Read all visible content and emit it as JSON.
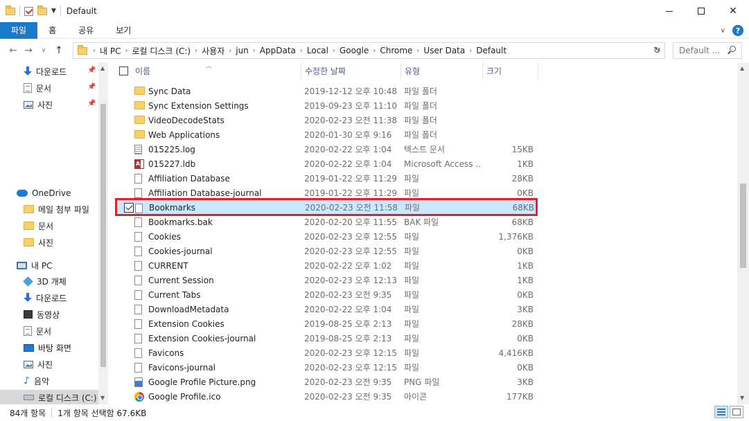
{
  "window": {
    "title": "Default"
  },
  "ribbon": {
    "tabs": [
      {
        "label": "파일"
      },
      {
        "label": "홈"
      },
      {
        "label": "공유"
      },
      {
        "label": "보기"
      }
    ]
  },
  "address": {
    "crumbs": [
      "내 PC",
      "로컬 디스크 (C:)",
      "사용자",
      "jun",
      "AppData",
      "Local",
      "Google",
      "Chrome",
      "User Data",
      "Default"
    ],
    "search_placeholder": "Default ..."
  },
  "sidebar": {
    "quick": [
      {
        "label": "다운로드",
        "icon": "download-icon"
      },
      {
        "label": "문서",
        "icon": "document-icon"
      },
      {
        "label": "사진",
        "icon": "pictures-icon"
      }
    ],
    "onedrive": {
      "label": "OneDrive",
      "icon": "onedrive-icon"
    },
    "onedrive_items": [
      {
        "label": "메일 첨부 파일"
      },
      {
        "label": "문서"
      },
      {
        "label": "사진"
      }
    ],
    "thispc": {
      "label": "내 PC",
      "icon": "pc-icon"
    },
    "pc_items": [
      {
        "label": "3D 개체",
        "icon": "3d-objects-icon"
      },
      {
        "label": "다운로드",
        "icon": "download-icon"
      },
      {
        "label": "동영상",
        "icon": "video-icon"
      },
      {
        "label": "문서",
        "icon": "document-icon"
      },
      {
        "label": "바탕 화면",
        "icon": "desktop-icon"
      },
      {
        "label": "사진",
        "icon": "pictures-icon"
      },
      {
        "label": "음악",
        "icon": "music-icon"
      },
      {
        "label": "로컬 디스크 (C:)",
        "icon": "drive-icon"
      }
    ]
  },
  "columns": {
    "name": "이름",
    "date": "수정한 날짜",
    "type": "유형",
    "size": "크기"
  },
  "files": [
    {
      "name": "Sync Data",
      "date": "2019-12-12 오후 10:48",
      "type": "파일 폴더",
      "size": "",
      "icon": "folder-icon"
    },
    {
      "name": "Sync Extension Settings",
      "date": "2019-09-23 오후 11:10",
      "type": "파일 폴더",
      "size": "",
      "icon": "folder-icon"
    },
    {
      "name": "VideoDecodeStats",
      "date": "2020-02-23 오전 11:38",
      "type": "파일 폴더",
      "size": "",
      "icon": "folder-icon"
    },
    {
      "name": "Web Applications",
      "date": "2020-01-30 오후 9:16",
      "type": "파일 폴더",
      "size": "",
      "icon": "folder-icon"
    },
    {
      "name": "015225.log",
      "date": "2020-02-22 오후 1:04",
      "type": "텍스트 문서",
      "size": "15KB",
      "icon": "text-file-icon"
    },
    {
      "name": "015227.ldb",
      "date": "2020-02-22 오후 1:04",
      "type": "Microsoft Access ...",
      "size": "1KB",
      "icon": "access-file-icon"
    },
    {
      "name": "Affiliation Database",
      "date": "2019-01-22 오후 11:29",
      "type": "파일",
      "size": "28KB",
      "icon": "file-icon"
    },
    {
      "name": "Affiliation Database-journal",
      "date": "2019-01-22 오후 11:29",
      "type": "파일",
      "size": "0KB",
      "icon": "file-icon"
    },
    {
      "name": "Bookmarks",
      "date": "2020-02-23 오전 11:58",
      "type": "파일",
      "size": "68KB",
      "icon": "file-icon",
      "selected": true
    },
    {
      "name": "Bookmarks.bak",
      "date": "2020-02-20 오후 11:55",
      "type": "BAK 파일",
      "size": "68KB",
      "icon": "file-icon"
    },
    {
      "name": "Cookies",
      "date": "2020-02-23 오후 12:55",
      "type": "파일",
      "size": "1,376KB",
      "icon": "file-icon"
    },
    {
      "name": "Cookies-journal",
      "date": "2020-02-23 오후 12:55",
      "type": "파일",
      "size": "0KB",
      "icon": "file-icon"
    },
    {
      "name": "CURRENT",
      "date": "2020-02-22 오후 1:02",
      "type": "파일",
      "size": "1KB",
      "icon": "file-icon"
    },
    {
      "name": "Current Session",
      "date": "2020-02-23 오후 12:13",
      "type": "파일",
      "size": "1KB",
      "icon": "file-icon"
    },
    {
      "name": "Current Tabs",
      "date": "2020-02-23 오전 9:35",
      "type": "파일",
      "size": "0KB",
      "icon": "file-icon"
    },
    {
      "name": "DownloadMetadata",
      "date": "2020-02-22 오후 1:04",
      "type": "파일",
      "size": "3KB",
      "icon": "file-icon"
    },
    {
      "name": "Extension Cookies",
      "date": "2019-08-25 오후 2:13",
      "type": "파일",
      "size": "28KB",
      "icon": "file-icon"
    },
    {
      "name": "Extension Cookies-journal",
      "date": "2019-08-25 오후 2:13",
      "type": "파일",
      "size": "0KB",
      "icon": "file-icon"
    },
    {
      "name": "Favicons",
      "date": "2020-02-23 오후 12:15",
      "type": "파일",
      "size": "4,416KB",
      "icon": "file-icon"
    },
    {
      "name": "Favicons-journal",
      "date": "2020-02-23 오후 12:15",
      "type": "파일",
      "size": "0KB",
      "icon": "file-icon"
    },
    {
      "name": "Google Profile Picture.png",
      "date": "2020-02-23 오전 9:35",
      "type": "PNG 파일",
      "size": "3KB",
      "icon": "png-file-icon"
    },
    {
      "name": "Google Profile.ico",
      "date": "2020-02-23 오전 9:35",
      "type": "아이콘",
      "size": "177KB",
      "icon": "chrome-icon"
    }
  ],
  "status": {
    "count": "84개 항목",
    "selection": "1개 항목 선택함 67.6KB"
  },
  "colors": {
    "accent": "#1979ca",
    "selection_bg": "#cce8ff",
    "highlight_border": "#e0232b"
  }
}
